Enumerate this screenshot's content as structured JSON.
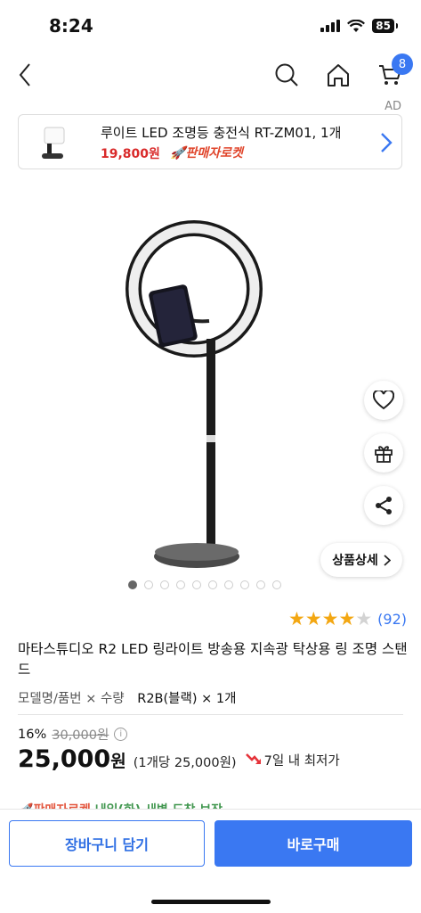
{
  "status_bar": {
    "time": "8:24",
    "battery": "85"
  },
  "header": {
    "cart_count": "8"
  },
  "ad": {
    "label": "AD",
    "title": "루이트 LED 조명등 충전식 RT-ZM01, 1개",
    "price": "19,800원",
    "badge": "판매자로켓"
  },
  "gallery": {
    "image_count": 10,
    "active_index": 0
  },
  "detail_button": "상품상세",
  "rating": {
    "stars": 4,
    "count": "(92)"
  },
  "product": {
    "title": "마타스튜디오 R2 LED 링라이트 방송용 지속광 탁상용 링 조명 스탠드",
    "option_label": "모델명/품번 × 수량",
    "option_value": "R2B(블랙) × 1개",
    "discount_rate": "16%",
    "original_price": "30,000원",
    "price": "25,000",
    "price_unit": "원",
    "unit_price": "(1개당 25,000원)",
    "lowest_label": "7일 내 최저가"
  },
  "peek_text": {
    "rocket": "판매자로켓",
    "rest": "내일(화) 새벽 도착 보장"
  },
  "buttons": {
    "cart": "장바구니 담기",
    "buy": "바로구매"
  },
  "colors": {
    "accent": "#3a78f2",
    "price_red": "#d92a2a",
    "star": "#f3a712"
  }
}
